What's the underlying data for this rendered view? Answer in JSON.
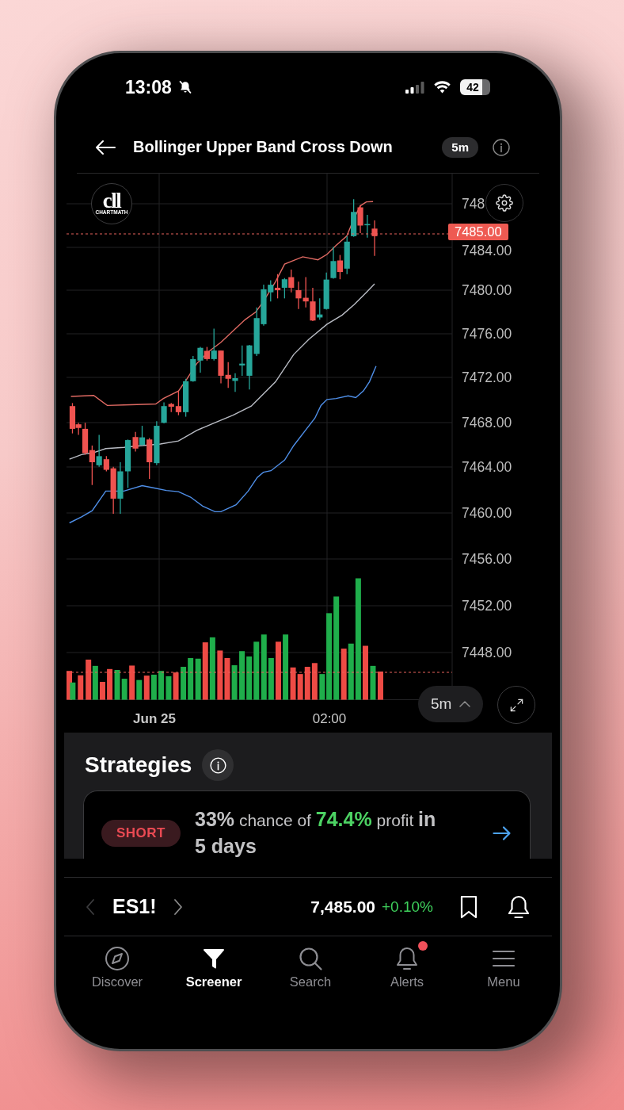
{
  "status_bar": {
    "time": "13:08",
    "silent": true,
    "battery": "42"
  },
  "header": {
    "title": "Bollinger Upper Band Cross Down",
    "interval": "5m"
  },
  "chart": {
    "logo": {
      "mark": "cll",
      "name": "CHARTMATH"
    },
    "price_labels": [
      "748",
      "7484.00",
      "7480.00",
      "7476.00",
      "7472.00",
      "7468.00",
      "7464.00",
      "7460.00",
      "7456.00",
      "7452.00",
      "7448.00"
    ],
    "last_price": "7485.00",
    "time_labels": [
      {
        "text": "Jun 25",
        "kind": "date"
      },
      {
        "text": "02:00",
        "kind": "time"
      }
    ],
    "interval": "5m"
  },
  "strategies": {
    "title": "Strategies",
    "cards": [
      {
        "kind": "short",
        "side": "SHORT",
        "parts": [
          {
            "kind": "strong",
            "text": "33%"
          },
          {
            "kind": "plain",
            "text": "chance of"
          },
          {
            "kind": "gain",
            "text": "74.4%"
          },
          {
            "kind": "plain",
            "text": "profit"
          },
          {
            "kind": "strong",
            "text": "in 5 days"
          }
        ]
      }
    ]
  },
  "ticker": {
    "symbol": "ES1!",
    "price": "7,485.00",
    "change": "+0.10%",
    "positive": true
  },
  "tabs": [
    {
      "label": "Discover",
      "selected": false,
      "badge": false
    },
    {
      "label": "Screener",
      "selected": true,
      "badge": false
    },
    {
      "label": "Search",
      "selected": false,
      "badge": false
    },
    {
      "label": "Alerts",
      "selected": false,
      "badge": true
    },
    {
      "label": "Menu",
      "selected": false,
      "badge": false
    }
  ]
}
